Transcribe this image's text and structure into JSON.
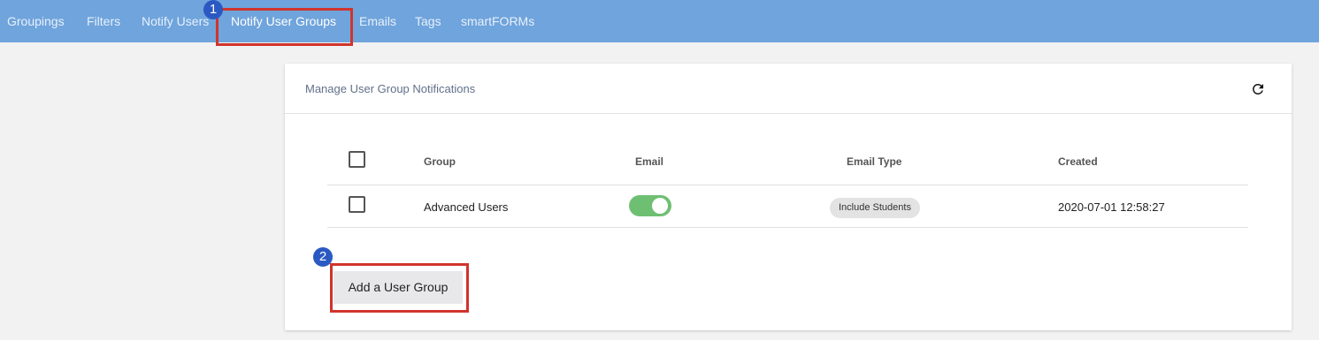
{
  "nav": {
    "items": [
      {
        "label": "Groupings"
      },
      {
        "label": "Filters"
      },
      {
        "label": "Notify Users"
      },
      {
        "label": "Notify User Groups",
        "active": true
      },
      {
        "label": "Emails"
      },
      {
        "label": "Tags"
      },
      {
        "label": "smartFORMs"
      }
    ]
  },
  "callouts": {
    "one": "1",
    "two": "2"
  },
  "card": {
    "title": "Manage User Group Notifications",
    "refresh_icon": "refresh-icon"
  },
  "table": {
    "headers": {
      "group": "Group",
      "email": "Email",
      "email_type": "Email Type",
      "created": "Created"
    },
    "rows": [
      {
        "group": "Advanced Users",
        "email_enabled": true,
        "email_type": "Include Students",
        "created": "2020-07-01 12:58:27"
      }
    ]
  },
  "actions": {
    "add_group_label": "Add a User Group"
  },
  "colors": {
    "nav_bg": "#6fa4dc",
    "callout_border": "#d0342c",
    "badge_bg": "#2b59c3",
    "toggle_on": "#6fbf73"
  }
}
